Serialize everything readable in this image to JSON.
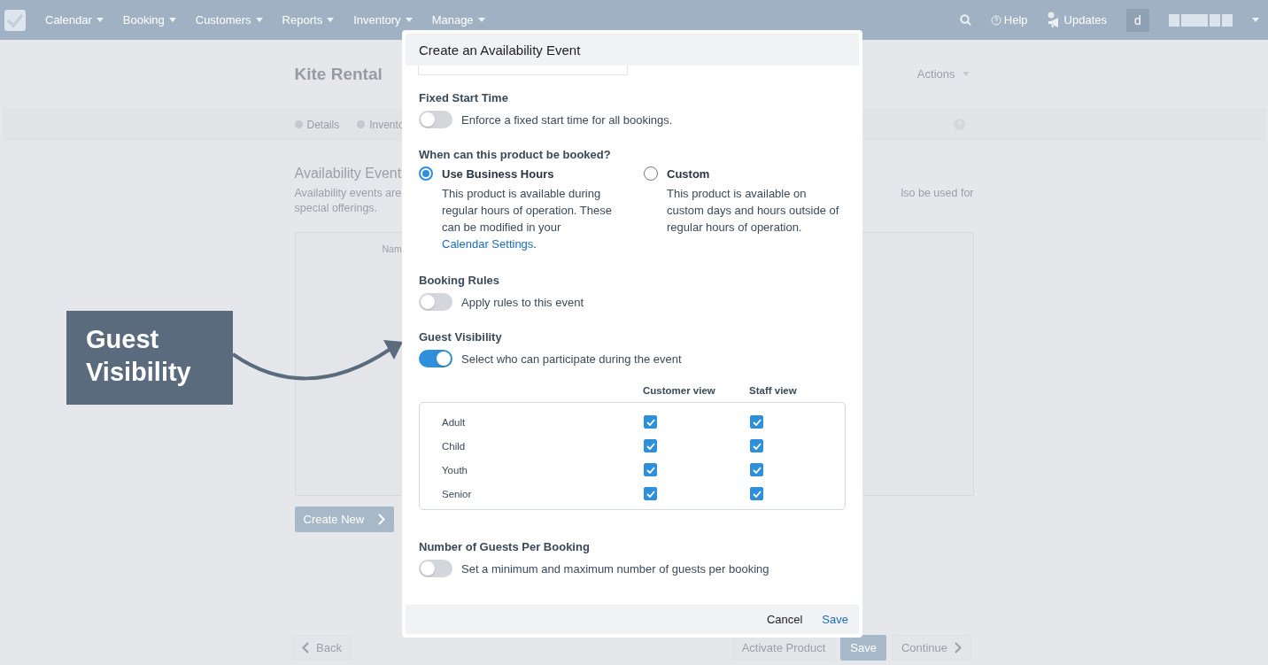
{
  "nav": {
    "items": [
      {
        "label": "Calendar"
      },
      {
        "label": "Booking"
      },
      {
        "label": "Customers"
      },
      {
        "label": "Reports"
      },
      {
        "label": "Inventory"
      },
      {
        "label": "Manage"
      }
    ],
    "help": "Help",
    "updates": "Updates",
    "avatar": "d"
  },
  "page": {
    "title": "Kite Rental",
    "actions": "Actions",
    "steps": [
      {
        "label": "Details"
      },
      {
        "label": "Invento"
      }
    ],
    "section_title": "Availability Event",
    "description_left": "Availability events are",
    "description_right": "lso be used for",
    "description_line2": "special offerings.",
    "table_header": "Nam",
    "create_button": "Create New",
    "back": "Back",
    "activate": "Activate Product",
    "save": "Save",
    "continue": "Continue"
  },
  "callout": {
    "text": "Guest Visibility"
  },
  "modal": {
    "title": "Create an Availability Event",
    "sections": [
      {
        "kind": "toggle",
        "heading": "Fixed Start Time",
        "label": "Enforce a fixed start time for all bookings.",
        "on": false
      },
      {
        "kind": "radio",
        "heading": "When can this product be booked?",
        "options": [
          {
            "title": "Use Business Hours",
            "text": "This product is available during regular hours of operation. These can be modified in your",
            "link": "Calendar Settings",
            "after": ".",
            "selected": true
          },
          {
            "title": "Custom",
            "text": "This product is available on custom days and hours outside of regular hours of operation.",
            "selected": false
          }
        ]
      },
      {
        "kind": "toggle",
        "heading": "Booking Rules",
        "label": "Apply rules to this event",
        "on": false
      },
      {
        "kind": "toggle",
        "heading": "Guest Visibility",
        "label": "Select who can participate during the event",
        "on": true
      },
      {
        "kind": "guests",
        "columns": [
          "Customer view",
          "Staff view"
        ],
        "rows": [
          {
            "label": "Adult",
            "customer": true,
            "staff": true
          },
          {
            "label": "Child",
            "customer": true,
            "staff": true
          },
          {
            "label": "Youth",
            "customer": true,
            "staff": true
          },
          {
            "label": "Senior",
            "customer": true,
            "staff": true
          }
        ]
      },
      {
        "kind": "toggle",
        "heading": "Number of Guests Per Booking",
        "label": "Set a minimum and maximum number of guests per booking",
        "on": false
      }
    ],
    "cancel": "Cancel",
    "save": "Save"
  }
}
